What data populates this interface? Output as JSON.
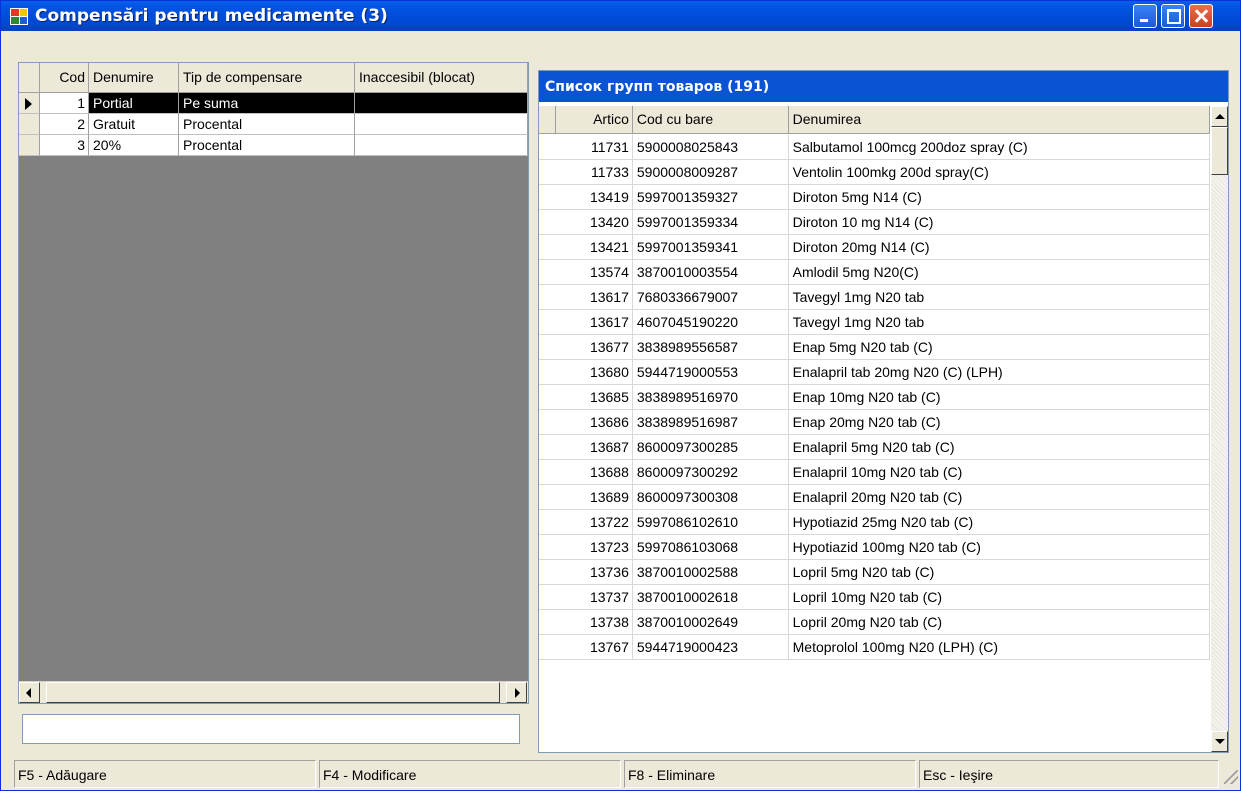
{
  "window": {
    "title": "Compensări pentru medicamente (3)",
    "controls": [
      "minimize",
      "maximize",
      "close"
    ]
  },
  "compensations": {
    "columns": [
      "Cod",
      "Denumire",
      "Tip de compensare",
      "Inaccesibil (blocat)"
    ],
    "rows": [
      {
        "cod": "1",
        "denumire": "Portial",
        "tip": "Pe suma",
        "inaccesibil": ""
      },
      {
        "cod": "2",
        "denumire": "Gratuit",
        "tip": "Procental",
        "inaccesibil": ""
      },
      {
        "cod": "3",
        "denumire": "20%",
        "tip": "Procental",
        "inaccesibil": ""
      }
    ],
    "selected_row": 0,
    "filter_value": ""
  },
  "products": {
    "caption": "Список групп товаров (191)",
    "columns": [
      "Artico",
      "Cod cu bare",
      "Denumirea"
    ],
    "rows": [
      {
        "articol": "11731",
        "cod": "5900008025843",
        "denumire": "Salbutamol 100mcg 200doz spray (C)"
      },
      {
        "articol": "11733",
        "cod": "5900008009287",
        "denumire": "Ventolin 100mkg 200d spray(C)"
      },
      {
        "articol": "13419",
        "cod": "5997001359327",
        "denumire": "Diroton  5mg N14 (C)"
      },
      {
        "articol": "13420",
        "cod": "5997001359334",
        "denumire": "Diroton 10 mg N14 (C)"
      },
      {
        "articol": "13421",
        "cod": "5997001359341",
        "denumire": "Diroton  20mg N14 (C)"
      },
      {
        "articol": "13574",
        "cod": "3870010003554",
        "denumire": "Amlodil  5mg N20(C)"
      },
      {
        "articol": "13617",
        "cod": "7680336679007",
        "denumire": "Tavegyl  1mg N20 tab"
      },
      {
        "articol": "13617",
        "cod": "4607045190220",
        "denumire": "Tavegyl  1mg N20 tab"
      },
      {
        "articol": "13677",
        "cod": "3838989556587",
        "denumire": "Enap  5mg N20 tab (C)"
      },
      {
        "articol": "13680",
        "cod": "5944719000553",
        "denumire": "Enalapril tab 20mg N20 (C) (LPH)"
      },
      {
        "articol": "13685",
        "cod": "3838989516970",
        "denumire": "Enap 10mg N20 tab (C)"
      },
      {
        "articol": "13686",
        "cod": "3838989516987",
        "denumire": "Enap 20mg N20 tab (C)"
      },
      {
        "articol": "13687",
        "cod": "8600097300285",
        "denumire": "Enalapril  5mg N20 tab (C)"
      },
      {
        "articol": "13688",
        "cod": "8600097300292",
        "denumire": "Enalapril  10mg N20  tab (C)"
      },
      {
        "articol": "13689",
        "cod": "8600097300308",
        "denumire": "Enalapril  20mg N20 tab (C)"
      },
      {
        "articol": "13722",
        "cod": "5997086102610",
        "denumire": "Hypotiazid  25mg N20 tab (C)"
      },
      {
        "articol": "13723",
        "cod": "5997086103068",
        "denumire": "Hypotiazid 100mg N20 tab (C)"
      },
      {
        "articol": "13736",
        "cod": "3870010002588",
        "denumire": "Lopril 5mg N20 tab (C)"
      },
      {
        "articol": "13737",
        "cod": "3870010002618",
        "denumire": "Lopril 10mg N20  tab (C)"
      },
      {
        "articol": "13738",
        "cod": "3870010002649",
        "denumire": "Lopril 20mg N20 tab (C)"
      },
      {
        "articol": "13767",
        "cod": "5944719000423",
        "denumire": "Metoprolol  100mg N20  (LPH) (C)"
      }
    ]
  },
  "statusbar": {
    "f5": "F5 - Adăugare",
    "f4": "F4 - Modificare",
    "f8": "F8 - Eliminare",
    "esc": "Esc - Ieşire"
  },
  "colors": {
    "titlebar": "#0054e3",
    "caption": "#0a54d4",
    "selection": "#000000"
  }
}
